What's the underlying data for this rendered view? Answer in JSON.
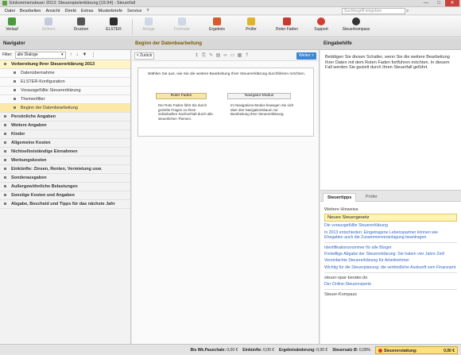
{
  "window": {
    "title": "Einkommensteuer 2013: Steuerspielerklärung [19.94] - Steuerfall",
    "minimize": "—",
    "maximize": "□",
    "close": "✕"
  },
  "menu": [
    "Datei",
    "Bearbeiten",
    "Ansicht",
    "Direkt",
    "Extras",
    "Musterbriefe",
    "Service",
    "?"
  ],
  "search": {
    "placeholder": "Suchbegriff eingeben"
  },
  "toolbar": {
    "verlauf": "Verlauf",
    "sichern": "Sichern",
    "drucken": "Drucken",
    "elster": "ELSTER",
    "anlage": "Anlage",
    "formular": "Formular",
    "ergebnis": "Ergebnis",
    "pruefer": "Prüfer",
    "roter_faden": "Roter Faden",
    "support": "Support",
    "steuerkompass": "Steuerkompass"
  },
  "navigator": {
    "title": "Navigator",
    "filter_label": "Filter:",
    "filter_value": "alle Dialoge",
    "items": [
      {
        "label": "Vorbereitung Ihrer Steuererklärung 2013"
      },
      {
        "label": "Datenübernahme"
      },
      {
        "label": "ELSTER-Konfiguration"
      },
      {
        "label": "Vorausgefüllte Steuererklärung"
      },
      {
        "label": "Themenfilter"
      },
      {
        "label": "Beginn der Datenbearbeitung"
      },
      {
        "label": "Persönliche Angaben"
      },
      {
        "label": "Weitere Angaben"
      },
      {
        "label": "Kinder"
      },
      {
        "label": "Allgemeine Kosten"
      },
      {
        "label": "Nichtselbstständige Einnahmen"
      },
      {
        "label": "Werbungskosten"
      },
      {
        "label": "Einkünfte: Zinsen, Renten, Vermietung usw."
      },
      {
        "label": "Sonderausgaben"
      },
      {
        "label": "Außergewöhnliche Belastungen"
      },
      {
        "label": "Sonstige Kosten und Angaben"
      },
      {
        "label": "Abgabe, Bescheid und Tipps für das nächste Jahr"
      }
    ]
  },
  "center": {
    "title": "Beginn der Datenbearbeitung",
    "back": "< Zurück",
    "next": "Weiter >",
    "intro": "Wählen Sie aus, wie Sie die weitere Bearbeitung Ihrer Steuererklärung durchführen möchten.",
    "btn_roter_faden": "Roter Faden",
    "btn_navigator": "Navigator-Modus",
    "desc_roter_faden": "Der Rote Faden führt Sie durch gezielte Fragen zu Ihren individuellen Sachverhalt durch alle steuerlichen Themen.",
    "desc_navigator": "Im Navigations-Modus bewegen Sie sich über den Navigationsbaum zur Bearbeitung Ihrer Steuererklärung."
  },
  "help": {
    "title": "Eingabehilfe",
    "text": "Betätigen Sie diesen Schalter, wenn Sie die weitere Bearbeitung Ihrer Daten mit dem Roten Faden fortführen möchten. In diesem Fall werden Sie gezielt durch Ihren Steuerfall geführt."
  },
  "tabs": {
    "steuertipps": "Steuertipps",
    "pruefer": "Prüfer"
  },
  "tips": {
    "section1": "Weitere Hinweise",
    "highlight": "Neues Steuergesetz",
    "links1": [
      "Die vorausgefüllte Steuererklärung",
      "In 2013 entschieden: Eingetragene Lebenspartner können wie Ehegatten auch die Zusammenveranlagung beantragen"
    ],
    "links2": [
      "Identifikationsnummer für alle Bürger",
      "Freiwillige Abgabe der Steuererklärung: Sie haben vier Jahre Zeit!",
      "Vereinfachte Steuererklärung für Arbeitnehmer",
      "Wichtig für die Steuerplanung: die verbindliche Auskunft vom Finanzamt"
    ],
    "section2": "steuer-spar-berater.de",
    "link3": "Der Online-Steuerexperte",
    "section3": "Steuer-Kompass"
  },
  "status": {
    "wk_label": "Bis Wk.Pauschale:",
    "wk_value": "0,00 €",
    "eink_label": "Einkünfte:",
    "eink_value": "0,00 €",
    "erg_label": "Ergebnisänderung:",
    "erg_value": "0,00 €",
    "satz_label": "Steuersatz Ø:",
    "satz_value": "0,00%",
    "refund_label": "Steuererstattung:",
    "refund_value": "0,00 €"
  },
  "colors": {
    "accent": "#3c86d3",
    "highlight": "#fde9a6",
    "refund": "#ffe17a"
  }
}
